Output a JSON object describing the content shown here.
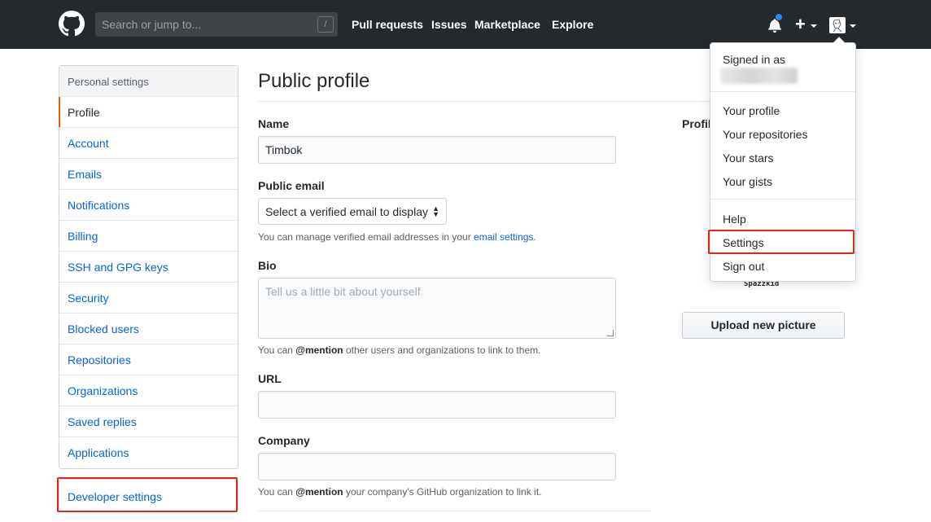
{
  "header": {
    "search_placeholder": "Search or jump to...",
    "search_shortcut": "/",
    "nav": [
      "Pull requests",
      "Issues",
      "Marketplace",
      "Explore"
    ],
    "plus": "+"
  },
  "sidebar": {
    "heading": "Personal settings",
    "items": [
      {
        "label": "Profile",
        "selected": true
      },
      {
        "label": "Account"
      },
      {
        "label": "Emails"
      },
      {
        "label": "Notifications"
      },
      {
        "label": "Billing"
      },
      {
        "label": "SSH and GPG keys"
      },
      {
        "label": "Security"
      },
      {
        "label": "Blocked users"
      },
      {
        "label": "Repositories"
      },
      {
        "label": "Organizations"
      },
      {
        "label": "Saved replies"
      },
      {
        "label": "Applications"
      }
    ],
    "developer_settings": "Developer settings"
  },
  "main": {
    "title": "Public profile",
    "name_label": "Name",
    "name_value": "Timbok",
    "email_label": "Public email",
    "email_select": "Select a verified email to display",
    "email_note_prefix": "You can manage verified email addresses in your ",
    "email_note_link": "email settings",
    "email_note_suffix": ".",
    "bio_label": "Bio",
    "bio_placeholder": "Tell us a little bit about yourself",
    "bio_note_prefix": "You can ",
    "bio_note_mention": "@mention",
    "bio_note_suffix": " other users and organizations to link to them.",
    "url_label": "URL",
    "url_value": "",
    "company_label": "Company",
    "company_value": "",
    "company_note_prefix": "You can ",
    "company_note_mention": "@mention",
    "company_note_suffix": " your company's GitHub organization to link it."
  },
  "right": {
    "profile_picture_label": "Profile",
    "avatar_caption": "Spazzkid",
    "upload_button": "Upload new picture"
  },
  "dropdown": {
    "signed_in_as": "Signed in as",
    "group1": [
      "Your profile",
      "Your repositories",
      "Your stars",
      "Your gists"
    ],
    "group2": [
      "Help",
      "Settings",
      "Sign out"
    ]
  },
  "colors": {
    "header_bg": "#24292e",
    "link": "#0366d6",
    "highlight_box": "#e0261d",
    "selected_accent": "#e36209",
    "notification_dot": "#2188ff"
  }
}
